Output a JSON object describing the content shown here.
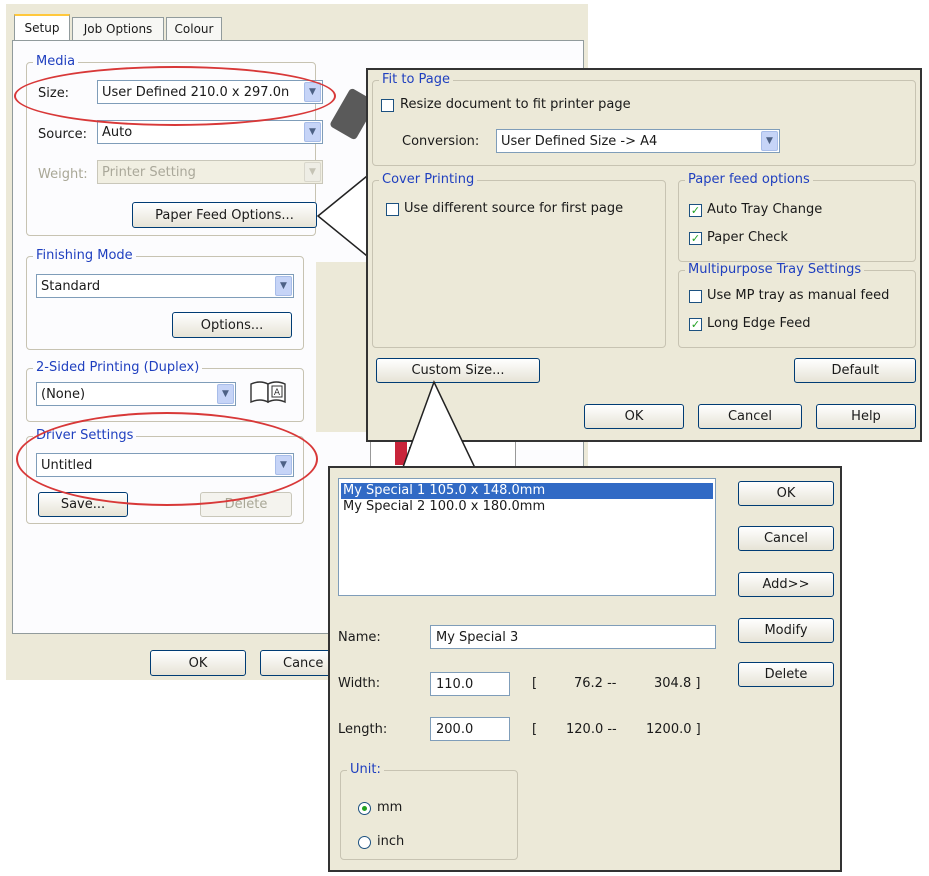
{
  "main_dialog": {
    "tabs": [
      {
        "label": "Setup"
      },
      {
        "label": "Job Options"
      },
      {
        "label": "Colour"
      }
    ],
    "media": {
      "label": "Media",
      "size_label": "Size:",
      "size_value": "User Defined 210.0 x 297.0n",
      "source_label": "Source:",
      "source_value": "Auto",
      "weight_label": "Weight:",
      "weight_value": "Printer Setting",
      "paper_feed_button": "Paper Feed Options..."
    },
    "finishing": {
      "label": "Finishing Mode",
      "value": "Standard",
      "options_button": "Options..."
    },
    "duplex": {
      "label": "2-Sided Printing (Duplex)",
      "value": "(None)"
    },
    "driver": {
      "label": "Driver Settings",
      "value": "Untitled",
      "save_button": "Save...",
      "delete_button": "Delete"
    },
    "ok_button": "OK",
    "cancel_button": "Cance"
  },
  "paper_feed_dialog": {
    "fit_to_page": {
      "label": "Fit to Page",
      "resize_checkbox": "Resize document to fit printer page",
      "resize_checked": false,
      "conversion_label": "Conversion:",
      "conversion_value": "User Defined Size -> A4"
    },
    "cover_printing": {
      "label": "Cover Printing",
      "checkbox": "Use different source for first page",
      "checked": false
    },
    "paper_feed_options": {
      "label": "Paper feed options",
      "auto_tray_change": "Auto Tray Change",
      "auto_tray_change_checked": true,
      "paper_check": "Paper Check",
      "paper_check_checked": true
    },
    "mp_tray": {
      "label": "Multipurpose Tray Settings",
      "manual_feed": "Use MP tray as manual feed",
      "manual_feed_checked": false,
      "long_edge_feed": "Long Edge Feed",
      "long_edge_feed_checked": true
    },
    "custom_size_button": "Custom Size...",
    "default_button": "Default",
    "ok_button": "OK",
    "cancel_button": "Cancel",
    "help_button": "Help"
  },
  "custom_size_dialog": {
    "list_items": [
      {
        "label": "My Special 1 105.0 x 148.0mm",
        "selected": true
      },
      {
        "label": "My Special 2 100.0 x 180.0mm",
        "selected": false
      }
    ],
    "buttons": {
      "ok": "OK",
      "cancel": "Cancel",
      "add": "Add>>",
      "modify": "Modify",
      "delete": "Delete"
    },
    "name_label": "Name:",
    "name_value": "My Special 3",
    "width_label": "Width:",
    "width_value": "110.0",
    "width_range_open": "[",
    "width_min": "76.2 --",
    "width_max": "304.8 ]",
    "length_label": "Length:",
    "length_value": "200.0",
    "length_range_open": "[",
    "length_min": "120.0 --",
    "length_max": "1200.0 ]",
    "unit_label": "Unit:",
    "unit_mm": "mm",
    "unit_inch": "inch",
    "unit_selected": "mm"
  },
  "colors": {
    "dialog_bg": "#ece9d8",
    "highlight": "#316ac5",
    "annotation_red": "#d83838",
    "group_label_blue": "#1f3fbf"
  }
}
